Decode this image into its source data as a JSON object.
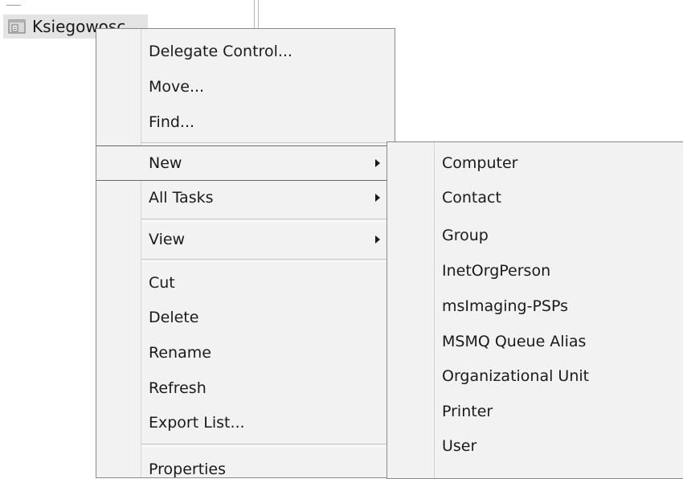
{
  "tree": {
    "node_label": "Ksiegowosc",
    "node_icon": "organizational-unit-icon"
  },
  "context_menu": {
    "items": [
      {
        "label": "Delegate Control..."
      },
      {
        "label": "Move..."
      },
      {
        "label": "Find..."
      },
      {
        "label": "New",
        "has_submenu": true,
        "highlighted": true
      },
      {
        "label": "All Tasks",
        "has_submenu": true
      },
      {
        "label": "View",
        "has_submenu": true
      },
      {
        "label": "Cut"
      },
      {
        "label": "Delete"
      },
      {
        "label": "Rename"
      },
      {
        "label": "Refresh"
      },
      {
        "label": "Export List..."
      },
      {
        "label": "Properties"
      }
    ],
    "submenu_arrow_icon": "chevron-right-icon"
  },
  "new_submenu": {
    "items": [
      {
        "label": "Computer"
      },
      {
        "label": "Contact"
      },
      {
        "label": "Group"
      },
      {
        "label": "InetOrgPerson"
      },
      {
        "label": "msImaging-PSPs"
      },
      {
        "label": "MSMQ Queue Alias"
      },
      {
        "label": "Organizational Unit"
      },
      {
        "label": "Printer"
      },
      {
        "label": "User"
      }
    ]
  }
}
